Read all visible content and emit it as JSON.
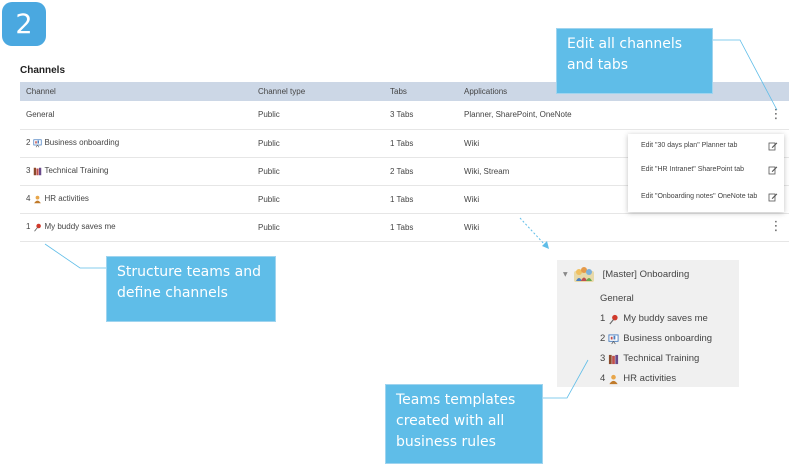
{
  "step": {
    "number": "2"
  },
  "section": {
    "title": "Channels"
  },
  "table": {
    "headers": {
      "channel": "Channel",
      "type": "Channel type",
      "tabs": "Tabs",
      "apps": "Applications"
    },
    "more_glyph": "⋮",
    "rows": [
      {
        "num": "",
        "icon": "",
        "name": "General",
        "type": "Public",
        "tabs": "3 Tabs",
        "apps": "Planner, SharePoint, OneNote",
        "has_more": true
      },
      {
        "num": "2",
        "icon": "presentation-icon",
        "name": "Business onboarding",
        "type": "Public",
        "tabs": "1 Tabs",
        "apps": "Wiki",
        "has_more": false
      },
      {
        "num": "3",
        "icon": "books-icon",
        "name": "Technical Training",
        "type": "Public",
        "tabs": "2 Tabs",
        "apps": "Wiki, Stream",
        "has_more": false
      },
      {
        "num": "4",
        "icon": "person-icon",
        "name": "HR activities",
        "type": "Public",
        "tabs": "1 Tabs",
        "apps": "Wiki",
        "has_more": false
      },
      {
        "num": "1",
        "icon": "pin-icon",
        "name": "My buddy saves me",
        "type": "Public",
        "tabs": "1 Tabs",
        "apps": "Wiki",
        "has_more": true
      }
    ]
  },
  "context_menu": {
    "items": [
      {
        "label": "Edit \"30 days plan\" Planner tab"
      },
      {
        "label": "Edit \"HR Intranet\" SharePoint tab"
      },
      {
        "label": "Edit \"Onboarding notes\" OneNote tab"
      }
    ]
  },
  "callouts": {
    "edit": "Edit all channels and tabs",
    "structure": "Structure teams and define channels",
    "templates": "Teams templates created with all business rules"
  },
  "tree": {
    "caret": "▼",
    "team": "[Master] Onboarding",
    "team_icon": "team-icon",
    "items": [
      {
        "num": "",
        "icon": "",
        "name": "General"
      },
      {
        "num": "1",
        "icon": "pin-icon",
        "name": "My buddy saves me"
      },
      {
        "num": "2",
        "icon": "presentation-icon",
        "name": "Business onboarding"
      },
      {
        "num": "3",
        "icon": "books-icon",
        "name": "Technical Training"
      },
      {
        "num": "4",
        "icon": "person-icon",
        "name": "HR activities"
      }
    ]
  },
  "colors": {
    "accent": "#5fbde8",
    "badge": "#4aa8e0",
    "table_header": "#ccd7e6",
    "tree_background": "#f0f0f0"
  }
}
